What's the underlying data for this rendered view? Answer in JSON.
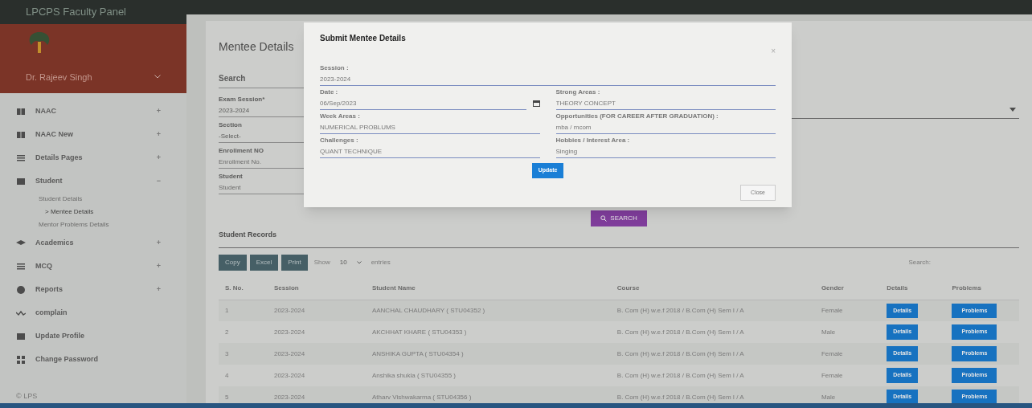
{
  "app_title": "LPCPS Faculty Panel",
  "user_name": "Dr. Rajeev Singh",
  "menu": [
    {
      "kind": "group",
      "label": "NAAC",
      "toggle": "+"
    },
    {
      "kind": "group",
      "label": "NAAC New",
      "toggle": "+"
    },
    {
      "kind": "group",
      "label": "Details Pages",
      "toggle": "+"
    },
    {
      "kind": "group",
      "label": "Student",
      "toggle": "−",
      "children": [
        {
          "label": "Student Details",
          "selected": false
        },
        {
          "label": "> Mentee Details",
          "selected": true
        },
        {
          "label": "Mentor Problems Details",
          "selected": false
        }
      ]
    },
    {
      "kind": "group",
      "label": "Academics",
      "toggle": "+"
    },
    {
      "kind": "group",
      "label": "MCQ",
      "toggle": "+"
    },
    {
      "kind": "group",
      "label": "Reports",
      "toggle": "+"
    },
    {
      "kind": "link",
      "label": "complain"
    },
    {
      "kind": "link",
      "label": "Update Profile"
    },
    {
      "kind": "link",
      "label": "Change Password"
    }
  ],
  "footer": "© LPS",
  "page_title": "Mentee Details",
  "search_heading": "Search",
  "search_fields": [
    {
      "label": "Exam Session*",
      "value": "2023-2024"
    },
    {
      "label": "Section",
      "value": "-Select-"
    },
    {
      "label": "Enrollment NO",
      "placeholder": "Enrollment No."
    },
    {
      "label": "Student",
      "placeholder": "Student"
    }
  ],
  "search_button": "SEARCH",
  "records_heading": "Student Records",
  "export_buttons": [
    "Copy",
    "Excel",
    "Print"
  ],
  "length_menu": {
    "show": "Show",
    "value": "10",
    "entries": "entries"
  },
  "table_search_label": "Search:",
  "table": {
    "columns": [
      "S. No.",
      "Session",
      "Student Name",
      "Course",
      "Gender",
      "Details",
      "Problems"
    ],
    "rows": [
      {
        "no": "1",
        "session": "2023-2024",
        "name": "AANCHAL CHAUDHARY ( STU04352 )",
        "course": "B. Com (H) w.e.f 2018 / B.Com (H) Sem I / A",
        "gender": "Female",
        "details": "Details",
        "problems": "Problems"
      },
      {
        "no": "2",
        "session": "2023-2024",
        "name": "AKCHHAT KHARE ( STU04353 )",
        "course": "B. Com (H) w.e.f 2018 / B.Com (H) Sem I / A",
        "gender": "Male",
        "details": "Details",
        "problems": "Problems"
      },
      {
        "no": "3",
        "session": "2023-2024",
        "name": "ANSHIKA GUPTA ( STU04354 )",
        "course": "B. Com (H) w.e.f 2018 / B.Com (H) Sem I / A",
        "gender": "Female",
        "details": "Details",
        "problems": "Problems"
      },
      {
        "no": "4",
        "session": "2023-2024",
        "name": "Anshika shukla ( STU04355 )",
        "course": "B. Com (H) w.e.f 2018 / B.Com (H) Sem I / A",
        "gender": "Female",
        "details": "Details",
        "problems": "Problems"
      },
      {
        "no": "5",
        "session": "2023-2024",
        "name": "Atharv Vishwakarma ( STU04356 )",
        "course": "B. Com (H) w.e.f 2018 / B.Com (H) Sem I / A",
        "gender": "Male",
        "details": "Details",
        "problems": "Problems"
      }
    ]
  },
  "modal": {
    "title": "Submit Mentee Details",
    "close_icon": "×",
    "session": {
      "label": "Session :",
      "value": "2023-2024"
    },
    "left_fields": [
      {
        "label": "Date :",
        "value": "06/Sep/2023",
        "kind": "date"
      },
      {
        "label": "Week Areas :",
        "value": "NUMERICAL PROBLUMS",
        "kind": "text"
      },
      {
        "label": "Challenges :",
        "value": "QUANT TECHNIQUE",
        "kind": "text"
      }
    ],
    "right_fields": [
      {
        "label": "Strong Areas :",
        "value": "THEORY CONCEPT",
        "kind": "text"
      },
      {
        "label": "Opportunities (FOR CAREER AFTER GRADUATION) :",
        "value": "mba / mcom",
        "kind": "text"
      },
      {
        "label": "Hobbies / Interest Area :",
        "value": "Singing",
        "kind": "text"
      }
    ],
    "update_button": "Update",
    "close_button": "Close"
  }
}
